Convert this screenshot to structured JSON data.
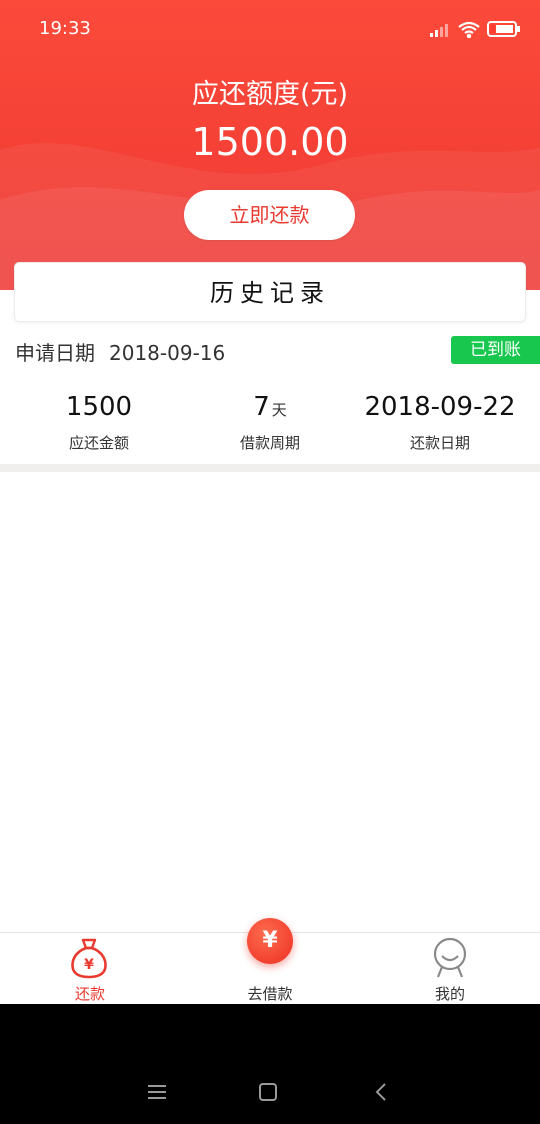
{
  "status_bar": {
    "time": "19:33"
  },
  "header": {
    "title": "应还额度(元)",
    "amount": "1500.00",
    "repay_button_label": "立即还款"
  },
  "history": {
    "title": "历史记录"
  },
  "record": {
    "apply_label": "申请日期",
    "apply_date": "2018-09-16",
    "badge": "已到账",
    "stats": [
      {
        "value": "1500",
        "unit": "",
        "label": "应还金额"
      },
      {
        "value": "7",
        "unit": "天",
        "label": "借款周期"
      },
      {
        "value": "2018-09-22",
        "unit": "",
        "label": "还款日期"
      }
    ]
  },
  "tabbar": {
    "tabs": [
      {
        "label": "还款",
        "icon": "money-bag-icon",
        "active": true
      },
      {
        "label": "去借款",
        "icon": "yuan-coin-icon",
        "active": false
      },
      {
        "label": "我的",
        "icon": "user-profile-icon",
        "active": false
      }
    ],
    "fab_symbol": "¥",
    "colors": {
      "active": "#e93a2f",
      "inactive": "#333333"
    }
  },
  "colors": {
    "brand": "#f44036",
    "badge": "#18c74d"
  }
}
